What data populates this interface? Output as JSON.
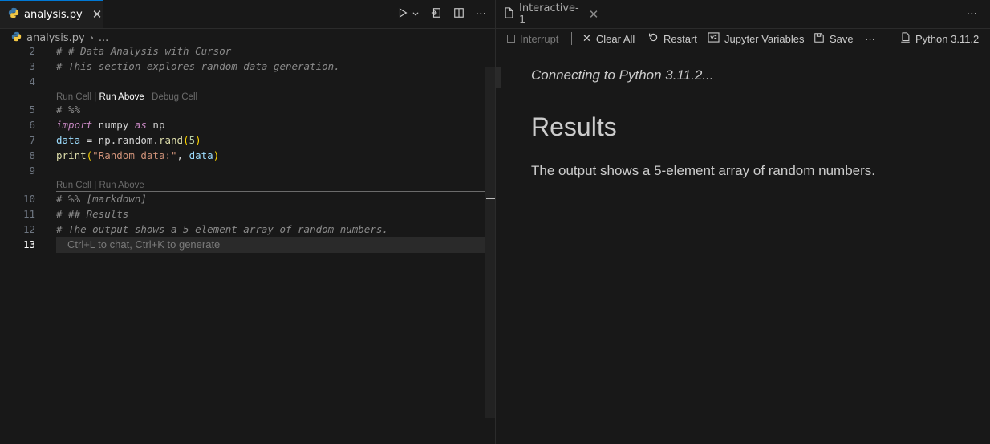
{
  "left_pane": {
    "tab": {
      "file_name": "analysis.py",
      "close_glyph": "✕"
    },
    "toolbar": {
      "icons": [
        "run-icon",
        "chevron-down-icon",
        "open-interactive-icon",
        "split-editor-icon",
        "more-icon"
      ]
    },
    "breadcrumb": {
      "file": "analysis.py",
      "separator": "›",
      "rest": "..."
    },
    "lines": [
      {
        "num": "2",
        "text": "# # Data Analysis with Cursor"
      },
      {
        "num": "3",
        "text": "# This section explores random data generation."
      },
      {
        "num": "4",
        "text": ""
      },
      {
        "num": "5",
        "text": "# %%"
      },
      {
        "num": "6",
        "text": "import numpy as np"
      },
      {
        "num": "7",
        "text": "data = np.random.rand(5)"
      },
      {
        "num": "8",
        "text": "print(\"Random data:\", data)"
      },
      {
        "num": "9",
        "text": ""
      },
      {
        "num": "10",
        "text": "# %% [markdown]"
      },
      {
        "num": "11",
        "text": "# ## Results"
      },
      {
        "num": "12",
        "text": "# The output shows a 5-element array of random numbers."
      },
      {
        "num": "13",
        "text": ""
      }
    ],
    "code_tokens": {
      "l6": {
        "import": "import",
        "mod": " numpy ",
        "as": "as",
        "alias": " np"
      },
      "l7": {
        "var": "data",
        "eq": " = np.random.",
        "fn": "rand",
        "open": "(",
        "num": "5",
        "close": ")"
      },
      "l8": {
        "fn": "print",
        "open": "(",
        "str": "\"Random data:\"",
        "comma": ", ",
        "var": "data",
        "close": ")"
      }
    },
    "codelens_1": {
      "run_cell": "Run Cell",
      "sep": " | ",
      "run_above": "Run Above",
      "debug_cell": "Debug Cell"
    },
    "codelens_2": {
      "run_cell": "Run Cell",
      "sep": " | ",
      "run_above": "Run Above"
    },
    "hint": "Ctrl+L to chat, Ctrl+K to generate"
  },
  "right_pane": {
    "tab": {
      "title": "Interactive-1",
      "close_glyph": "✕"
    },
    "more": "···",
    "toolbar": {
      "interrupt": "Interrupt",
      "clear_all": "Clear All",
      "restart": "Restart",
      "jupyter_variables": "Jupyter Variables",
      "save": "Save",
      "more": "···",
      "kernel": "Python 3.11.2"
    },
    "output": {
      "connecting": "Connecting to Python 3.11.2...",
      "heading": "Results",
      "paragraph": "The output shows a 5-element array of random numbers."
    }
  }
}
